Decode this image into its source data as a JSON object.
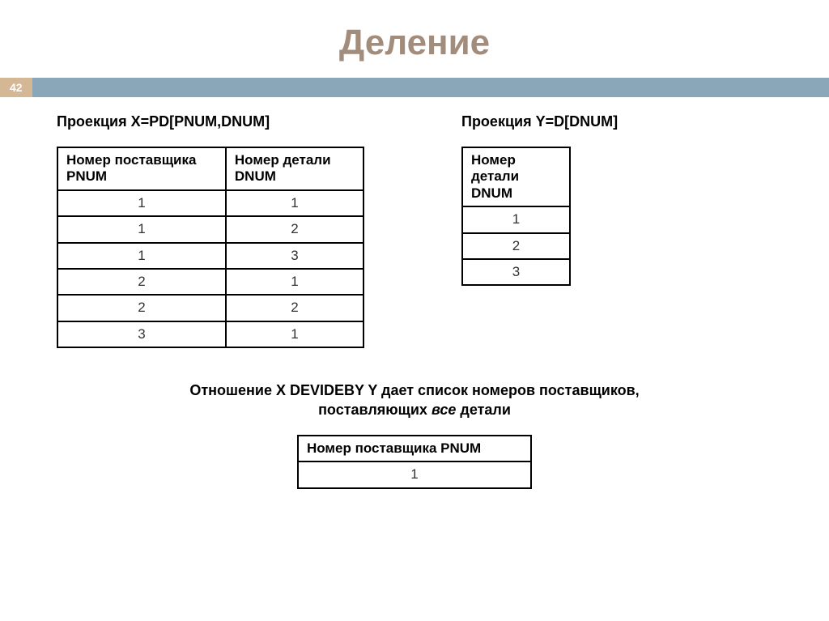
{
  "title": "Деление",
  "pageNumber": "42",
  "left": {
    "title": "Проекция X=PD[PNUM,DNUM]",
    "headers": [
      "Номер поставщика PNUM",
      "Номер детали DNUM"
    ],
    "rows": [
      [
        "1",
        "1"
      ],
      [
        "1",
        "2"
      ],
      [
        "1",
        "3"
      ],
      [
        "2",
        "1"
      ],
      [
        "2",
        "2"
      ],
      [
        "3",
        "1"
      ]
    ]
  },
  "right": {
    "title": "Проекция Y=D[DNUM]",
    "header": "Номер детали DNUM",
    "rows": [
      "1",
      "2",
      "3"
    ]
  },
  "caption": {
    "line1": "Отношение X DEVIDEBY Y дает список номеров поставщиков,",
    "line2_prefix": "поставляющих ",
    "line2_italic": "все",
    "line2_suffix": " детали"
  },
  "result": {
    "header": "Номер поставщика PNUM",
    "rows": [
      "1"
    ]
  }
}
